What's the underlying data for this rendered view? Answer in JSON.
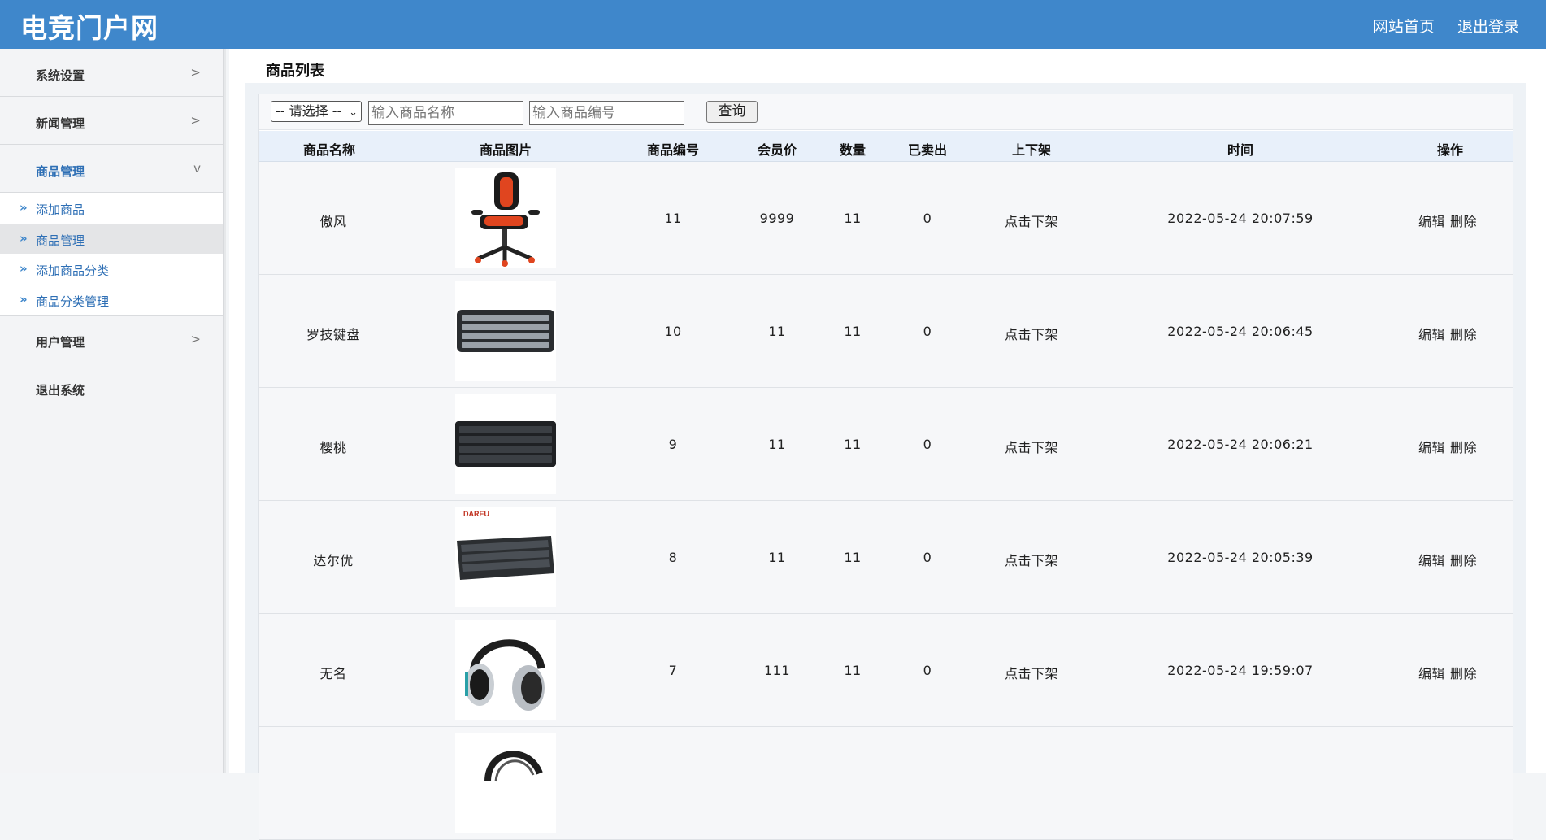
{
  "header": {
    "logo": "电竞门户网",
    "links": [
      "网站首页",
      "退出登录"
    ]
  },
  "sidebar": {
    "groups": [
      {
        "label": "系统设置",
        "arrow": ">"
      },
      {
        "label": "新闻管理",
        "arrow": ">"
      },
      {
        "label": "商品管理",
        "arrow": "v"
      },
      {
        "label": "用户管理",
        "arrow": ">"
      },
      {
        "label": "退出系统",
        "arrow": ""
      }
    ],
    "subitems": [
      {
        "label": "添加商品"
      },
      {
        "label": "商品管理"
      },
      {
        "label": "添加商品分类"
      },
      {
        "label": "商品分类管理"
      }
    ],
    "sub_arrow": "»"
  },
  "page": {
    "title": "商品列表"
  },
  "filter": {
    "select_value": "-- 请选择 --",
    "name_placeholder": "输入商品名称",
    "code_placeholder": "输入商品编号",
    "query_label": "查询"
  },
  "table": {
    "headers": [
      "商品名称",
      "商品图片",
      "商品编号",
      "会员价",
      "数量",
      "已卖出",
      "上下架",
      "时间",
      "操作"
    ],
    "rows": [
      {
        "name": "傲风",
        "image": "gaming-chair",
        "code": "11",
        "price": "9999",
        "qty": "11",
        "sold": "0",
        "shelf": "点击下架",
        "time": "2022-05-24 20:07:59",
        "edit": "编辑",
        "delete": "删除"
      },
      {
        "name": "罗技键盘",
        "image": "keyboard",
        "code": "10",
        "price": "11",
        "qty": "11",
        "sold": "0",
        "shelf": "点击下架",
        "time": "2022-05-24 20:06:45",
        "edit": "编辑",
        "delete": "删除"
      },
      {
        "name": "樱桃",
        "image": "keyboard",
        "code": "9",
        "price": "11",
        "qty": "11",
        "sold": "0",
        "shelf": "点击下架",
        "time": "2022-05-24 20:06:21",
        "edit": "编辑",
        "delete": "删除"
      },
      {
        "name": "达尔优",
        "image": "keyboard",
        "image_text": "DAREU",
        "code": "8",
        "price": "11",
        "qty": "11",
        "sold": "0",
        "shelf": "点击下架",
        "time": "2022-05-24 20:05:39",
        "edit": "编辑",
        "delete": "删除"
      },
      {
        "name": "无名",
        "image": "headphones",
        "code": "7",
        "price": "111",
        "qty": "11",
        "sold": "0",
        "shelf": "点击下架",
        "time": "2022-05-24 19:59:07",
        "edit": "编辑",
        "delete": "删除"
      }
    ]
  },
  "colors": {
    "header_bg": "#3f87cb",
    "link_blue": "#2e6fb5",
    "table_head_bg": "#e8f0fa"
  }
}
